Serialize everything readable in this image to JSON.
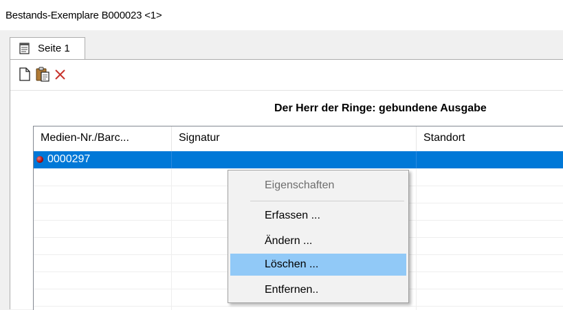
{
  "window": {
    "title": "Bestands-Exemplare B000023 <1>"
  },
  "tabs": [
    {
      "label": "Seite 1",
      "icon": "page-icon"
    }
  ],
  "toolbar": {
    "buttons": [
      {
        "name": "new-document-icon"
      },
      {
        "name": "paste-icon"
      },
      {
        "name": "delete-icon"
      }
    ]
  },
  "content": {
    "heading": "Der Herr der Ringe: gebundene Ausgabe"
  },
  "grid": {
    "columns": [
      "Medien-Nr./Barc...",
      "Signatur",
      "Standort"
    ],
    "rows": [
      {
        "medien_nr": "0000297",
        "signatur": "",
        "standort": "",
        "selected": true
      }
    ]
  },
  "context_menu": {
    "items": [
      {
        "label": "Eigenschaften",
        "disabled": true
      },
      {
        "label": "Erfassen ..."
      },
      {
        "label": "Ändern ..."
      },
      {
        "label": "Löschen ...",
        "hovered": true
      },
      {
        "label": "Entfernen.."
      }
    ]
  },
  "colors": {
    "selection": "#0078d7",
    "menu_hover": "#91c9f7",
    "delete_icon": "#c8342c"
  }
}
